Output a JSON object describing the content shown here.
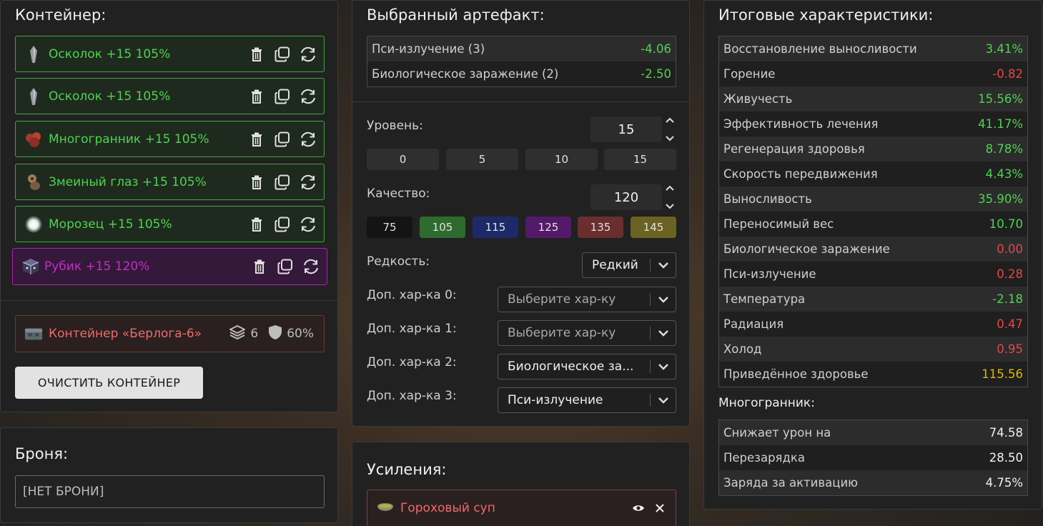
{
  "container": {
    "title": "Контейнер:",
    "items": [
      {
        "name": "Осколок +15 105%",
        "icon": "shard-icon"
      },
      {
        "name": "Осколок +15 105%",
        "icon": "shard-icon"
      },
      {
        "name": "Многогранник +15 105%",
        "icon": "polyhedron-icon"
      },
      {
        "name": "Змеиный глаз +15 105%",
        "icon": "snake-eye-icon"
      },
      {
        "name": "Морозец +15 105%",
        "icon": "frost-icon"
      },
      {
        "name": "Рубик +15 120%",
        "icon": "rubik-icon"
      }
    ],
    "container_name": "Контейнер «Берлога-6»",
    "slots": "6",
    "protection": "60%",
    "clear_label": "ОЧИСТИТЬ КОНТЕЙНЕР"
  },
  "armor": {
    "title": "Броня:",
    "value": "[НЕТ БРОНИ]"
  },
  "artifact": {
    "title": "Выбранный артефакт:",
    "stats": [
      {
        "label": "Пси-излучение (3)",
        "value": "-4.06"
      },
      {
        "label": "Биологическое заражение (2)",
        "value": "-2.50"
      }
    ],
    "level_label": "Уровень:",
    "level_value": "15",
    "level_presets": [
      "0",
      "5",
      "10",
      "15"
    ],
    "quality_label": "Качество:",
    "quality_value": "120",
    "quality_presets": [
      {
        "label": "75",
        "color": "#141414"
      },
      {
        "label": "105",
        "color": "#2e6b2e"
      },
      {
        "label": "115",
        "color": "#1c2a6a"
      },
      {
        "label": "125",
        "color": "#541a6a"
      },
      {
        "label": "135",
        "color": "#6a2e2e"
      },
      {
        "label": "145",
        "color": "#6a6220"
      }
    ],
    "rarity_label": "Редкость:",
    "rarity_value": "Редкий",
    "extra": [
      {
        "label": "Доп. хар-ка 0:",
        "value": "Выберите хар-ку",
        "placeholder": true
      },
      {
        "label": "Доп. хар-ка 1:",
        "value": "Выберите хар-ку",
        "placeholder": true
      },
      {
        "label": "Доп. хар-ка 2:",
        "value": "Биологическое за...",
        "placeholder": false
      },
      {
        "label": "Доп. хар-ка 3:",
        "value": "Пси-излучение",
        "placeholder": false
      }
    ]
  },
  "boosts": {
    "title": "Усиления:",
    "items": [
      {
        "name": "Гороховый суп",
        "icon": "soup-icon"
      }
    ]
  },
  "totals": {
    "title": "Итоговые характеристики:",
    "stats": [
      {
        "label": "Восстановление выносливости",
        "value": "3.41%",
        "tone": "green"
      },
      {
        "label": "Горение",
        "value": "-0.82",
        "tone": "red"
      },
      {
        "label": "Живучесть",
        "value": "15.56%",
        "tone": "green"
      },
      {
        "label": "Эффективность лечения",
        "value": "41.17%",
        "tone": "green"
      },
      {
        "label": "Регенерация здоровья",
        "value": "8.78%",
        "tone": "green"
      },
      {
        "label": "Скорость передвижения",
        "value": "4.43%",
        "tone": "green"
      },
      {
        "label": "Выносливость",
        "value": "35.90%",
        "tone": "green"
      },
      {
        "label": "Переносимый вес",
        "value": "10.70",
        "tone": "green"
      },
      {
        "label": "Биологическое заражение",
        "value": "0.00",
        "tone": "red"
      },
      {
        "label": "Пси-излучение",
        "value": "0.28",
        "tone": "red"
      },
      {
        "label": "Температура",
        "value": "-2.18",
        "tone": "green"
      },
      {
        "label": "Радиация",
        "value": "0.47",
        "tone": "red"
      },
      {
        "label": "Холод",
        "value": "0.95",
        "tone": "red"
      },
      {
        "label": "Приведённое здоровье",
        "value": "115.56",
        "tone": "yellow"
      }
    ],
    "polyhedron_title": "Многогранник:",
    "polyhedron_stats": [
      {
        "label": "Снижает урон на",
        "value": "74.58"
      },
      {
        "label": "Перезарядка",
        "value": "28.50"
      },
      {
        "label": "Заряда за активацию",
        "value": "4.75%"
      }
    ]
  }
}
